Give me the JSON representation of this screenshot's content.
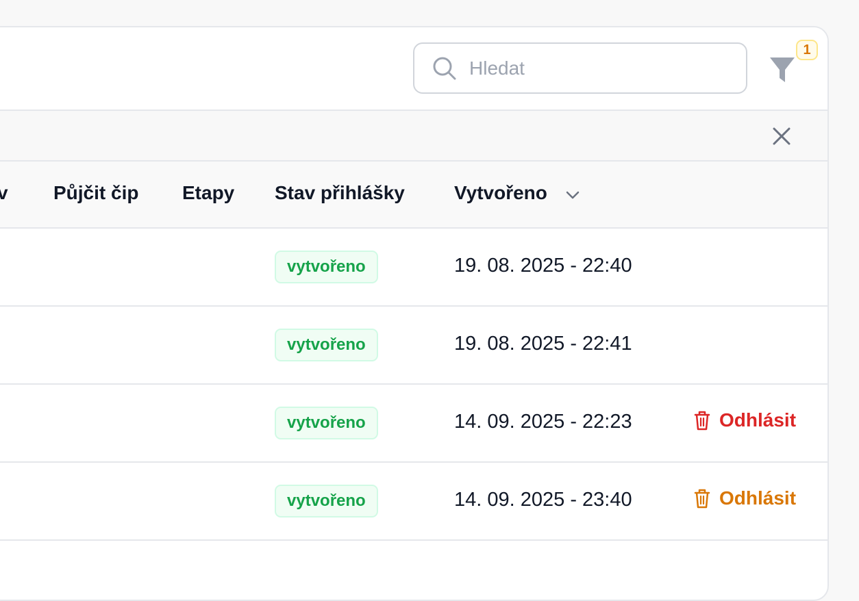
{
  "toolbar": {
    "search_placeholder": "Hledat",
    "filter_count": "1"
  },
  "table": {
    "columns": [
      {
        "label": "v"
      },
      {
        "label": "Půjčit čip"
      },
      {
        "label": "Etapy"
      },
      {
        "label": "Stav přihlášky"
      },
      {
        "label": "Vytvořeno"
      }
    ],
    "rows": [
      {
        "status": "vytvořeno",
        "created": "19. 08. 2025 - 22:40",
        "action": ""
      },
      {
        "status": "vytvořeno",
        "created": "19. 08. 2025 - 22:41",
        "action": ""
      },
      {
        "status": "vytvořeno",
        "created": "14. 09. 2025 - 22:23",
        "action": "Odhlásit"
      },
      {
        "status": "vytvořeno",
        "created": "14. 09. 2025 - 23:40",
        "action": "Odhlásit"
      }
    ]
  },
  "colors": {
    "danger": "#dc2626",
    "warning": "#d97706",
    "success": "#16a34a"
  },
  "icons": [
    "search-icon",
    "filter-icon",
    "close-icon",
    "chevron-down-icon",
    "trash-icon"
  ]
}
